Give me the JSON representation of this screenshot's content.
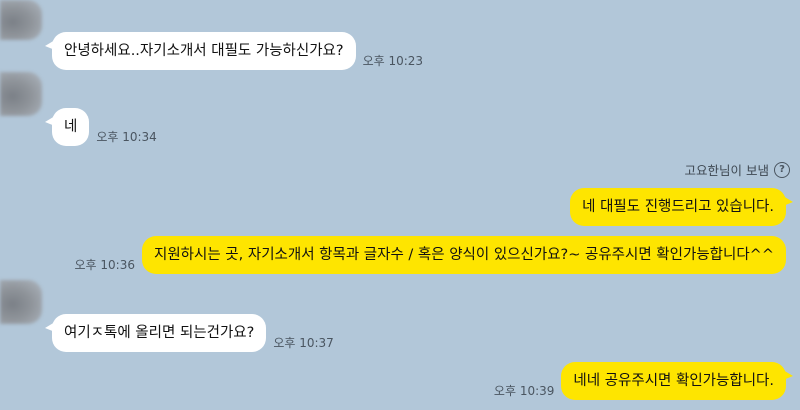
{
  "messages": [
    {
      "text": "안녕하세요..자기소개서 대필도 가능하신가요?",
      "time": "오후 10:23"
    },
    {
      "text": "네",
      "time": "오후 10:34"
    },
    {
      "text": "네 대필도 진행드리고 있습니다.",
      "time": ""
    },
    {
      "text": "지원하시는 곳, 자기소개서 항목과 글자수 / 혹은 양식이 있으신가요?~ 공유주시면 확인가능합니다^^",
      "time": "오후 10:36"
    },
    {
      "text": "여기ㅈ톡에 올리면 되는건가요?",
      "time": "오후 10:37"
    },
    {
      "text": "네네 공유주시면 확인가능합니다.",
      "time": "오후 10:39"
    }
  ],
  "sender_note": {
    "label": "고요한님이 보냄",
    "icon": "question-circle-icon"
  },
  "colors": {
    "background": "#b2c7d9",
    "incoming": "#ffffff",
    "outgoing": "#fee500"
  }
}
